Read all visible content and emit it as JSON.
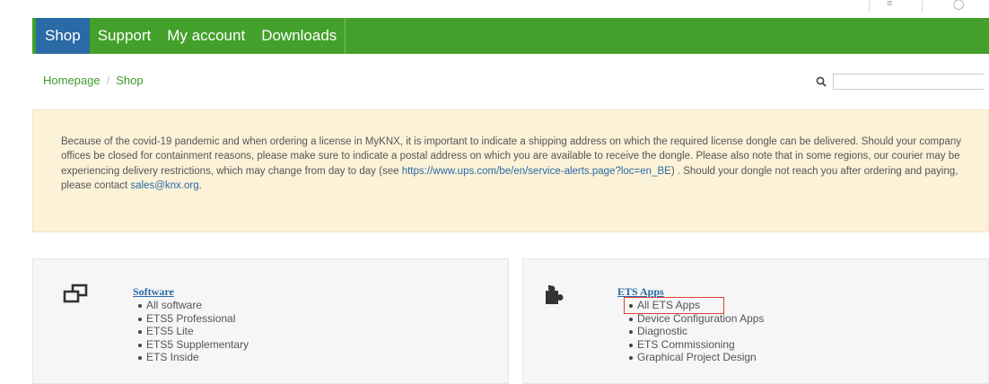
{
  "nav": {
    "items": [
      {
        "label": "Shop",
        "active": true
      },
      {
        "label": "Support",
        "active": false
      },
      {
        "label": "My account",
        "active": false
      },
      {
        "label": "Downloads",
        "active": false
      }
    ]
  },
  "breadcrumb": {
    "home": "Homepage",
    "separator": "/",
    "current": "Shop"
  },
  "search": {
    "placeholder": "",
    "icon": "search-icon"
  },
  "notice": {
    "text_before_link": "Because of the covid-19 pandemic and when ordering a license in MyKNX, it is important to indicate a shipping address on which the required license dongle can be delivered. Should your company offices be closed for containment reasons, please make sure to indicate a postal address on which you are available to receive the dongle. Please also note that in some regions, our courier may be experiencing delivery restrictions, which may change from day to day (see ",
    "link": "https://www.ups.com/be/en/service-alerts.page?loc=en_BE",
    "text_after_link": ") . Should your dongle not reach you after ordering and paying, please contact ",
    "email": "sales@knx.org",
    "text_end": "."
  },
  "panels": {
    "software": {
      "icon": "software-icon",
      "title": "Software",
      "items": [
        "All software",
        "ETS5 Professional",
        "ETS5 Lite",
        "ETS5 Supplementary",
        "ETS Inside"
      ]
    },
    "ets_apps": {
      "icon": "puzzle-icon",
      "title": "ETS Apps",
      "items": [
        "All ETS Apps",
        "Device Configuration Apps",
        "Diagnostic",
        "ETS Commissioning",
        "Graphical Project Design"
      ]
    }
  },
  "colors": {
    "nav_green": "#43a02a",
    "nav_active": "#2a6aa6",
    "notice_bg": "#fcf2d8",
    "link": "#2a6aa6",
    "highlight": "#e0413a"
  }
}
